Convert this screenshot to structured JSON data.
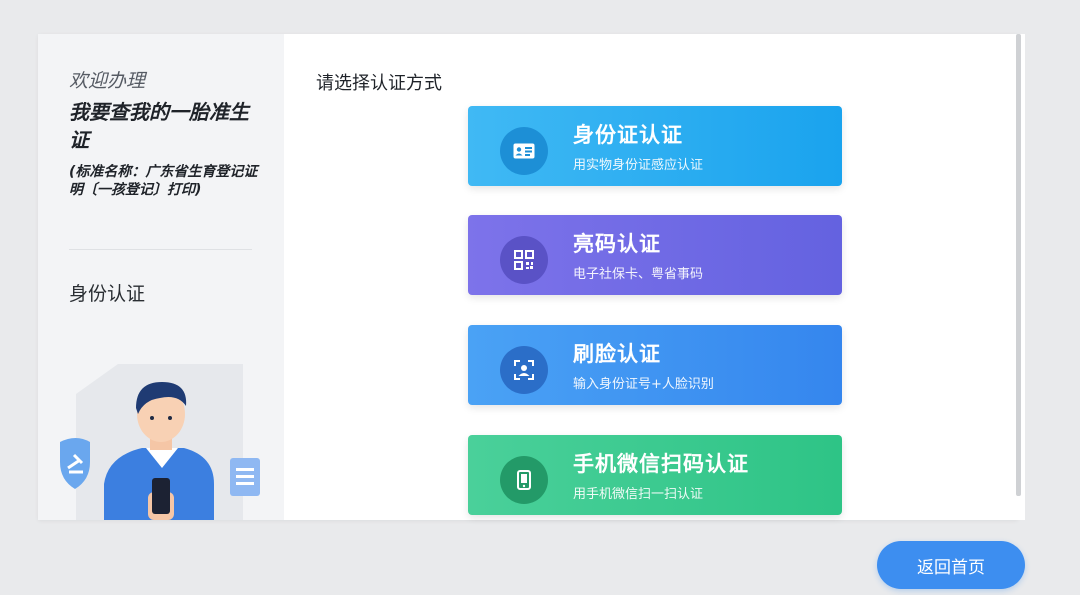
{
  "sidebar": {
    "welcome": "欢迎办理",
    "service_title": "我要查我的一胎准生证",
    "service_std": "(标准名称：广东省生育登记证明〔一孩登记〕打印)",
    "step": "身份认证"
  },
  "main": {
    "prompt": "请选择认证方式",
    "options": [
      {
        "label": "身份证认证",
        "desc": "用实物身份证感应认证",
        "icon": "id-card-icon",
        "color": "#1aa3ee"
      },
      {
        "label": "亮码认证",
        "desc": "电子社保卡、粤省事码",
        "icon": "qr-code-icon",
        "color": "#6462e0"
      },
      {
        "label": "刷脸认证",
        "desc": "输入身份证号+人脸识别",
        "icon": "face-scan-icon",
        "color": "#3586ee"
      },
      {
        "label": "手机微信扫码认证",
        "desc": "用手机微信扫一扫认证",
        "icon": "phone-icon",
        "color": "#2ec486"
      }
    ]
  },
  "footer": {
    "home_label": "返回首页"
  }
}
